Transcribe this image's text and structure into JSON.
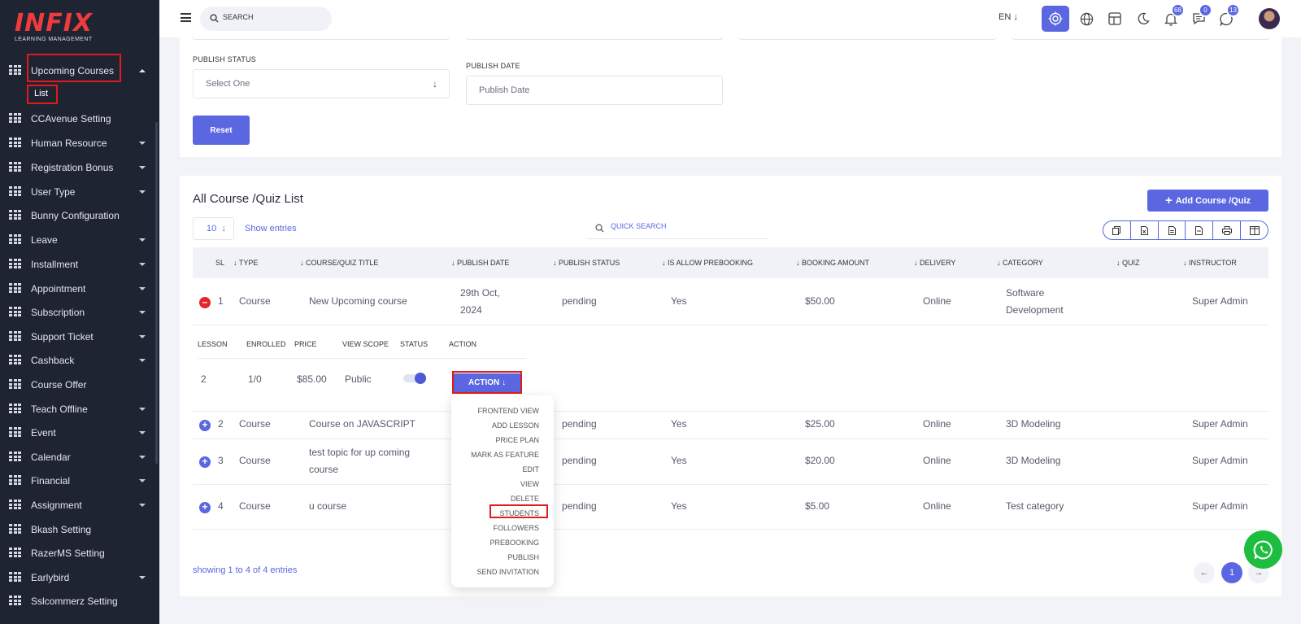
{
  "brand": {
    "name": "INFIX",
    "tagline": "LEARNING MANAGEMENT"
  },
  "sidebar": {
    "items": [
      {
        "label": "Upcoming Courses",
        "expanded": true
      },
      {
        "label": "CCAvenue Setting",
        "has_children": false
      },
      {
        "label": "Human Resource",
        "has_children": true
      },
      {
        "label": "Registration Bonus",
        "has_children": true
      },
      {
        "label": "User Type",
        "has_children": true
      },
      {
        "label": "Bunny Configuration",
        "has_children": false
      },
      {
        "label": "Leave",
        "has_children": true
      },
      {
        "label": "Installment",
        "has_children": true
      },
      {
        "label": "Appointment",
        "has_children": true
      },
      {
        "label": "Subscription",
        "has_children": true
      },
      {
        "label": "Support Ticket",
        "has_children": true
      },
      {
        "label": "Cashback",
        "has_children": true
      },
      {
        "label": "Course Offer",
        "has_children": false
      },
      {
        "label": "Teach Offline",
        "has_children": true
      },
      {
        "label": "Event",
        "has_children": true
      },
      {
        "label": "Calendar",
        "has_children": true
      },
      {
        "label": "Financial",
        "has_children": true
      },
      {
        "label": "Assignment",
        "has_children": true
      },
      {
        "label": "Bkash Setting",
        "has_children": false
      },
      {
        "label": "RazerMS Setting",
        "has_children": false
      },
      {
        "label": "Earlybird",
        "has_children": true
      },
      {
        "label": "Sslcommerz Setting",
        "has_children": false
      }
    ],
    "sub_item": "List"
  },
  "topbar": {
    "search_placeholder": "SEARCH",
    "language": "EN",
    "badges": {
      "notifications": "68",
      "messages": "0",
      "whatsapp": "13"
    }
  },
  "filters": {
    "publish_status_label": "PUBLISH STATUS",
    "publish_status_value": "Select One",
    "publish_date_label": "PUBLISH DATE",
    "publish_date_placeholder": "Publish Date",
    "reset_label": "Reset"
  },
  "list": {
    "title": "All Course /Quiz List",
    "add_button": "Add Course /Quiz",
    "entries_value": "10",
    "show_entries": "Show entries",
    "quick_search_placeholder": "QUICK SEARCH",
    "columns": [
      "SL",
      "TYPE",
      "COURSE/QUIZ TITLE",
      "PUBLISH DATE",
      "PUBLISH STATUS",
      "IS ALLOW PREBOOKING",
      "BOOKING AMOUNT",
      "DELIVERY",
      "CATEGORY",
      "QUIZ",
      "INSTRUCTOR"
    ],
    "rows": [
      {
        "sl": "1",
        "type": "Course",
        "title": "New Upcoming course",
        "date_line1": "29th Oct,",
        "date_line2": "2024",
        "status": "pending",
        "prebooking": "Yes",
        "amount": "$50.00",
        "delivery": "Online",
        "category_line1": "Software",
        "category_line2": "Development",
        "quiz": "",
        "instructor": "Super Admin"
      },
      {
        "sl": "2",
        "type": "Course",
        "title": "Course on JAVASCRIPT",
        "status": "pending",
        "prebooking": "Yes",
        "amount": "$25.00",
        "delivery": "Online",
        "category": "3D Modeling",
        "quiz": "",
        "instructor": "Super Admin"
      },
      {
        "sl": "3",
        "type": "Course",
        "title_line1": "test topic for up coming",
        "title_line2": "course",
        "status": "pending",
        "prebooking": "Yes",
        "amount": "$20.00",
        "delivery": "Online",
        "category": "3D Modeling",
        "quiz": "",
        "instructor": "Super Admin"
      },
      {
        "sl": "4",
        "type": "Course",
        "title": "u course",
        "status": "pending",
        "prebooking": "Yes",
        "amount": "$5.00",
        "delivery": "Online",
        "category": "Test category",
        "quiz": "",
        "instructor": "Super Admin"
      }
    ],
    "detail": {
      "columns": [
        "LESSON",
        "ENROLLED",
        "PRICE",
        "VIEW SCOPE",
        "STATUS",
        "ACTION"
      ],
      "lesson": "2",
      "enrolled": "1/0",
      "price": "$85.00",
      "view_scope": "Public",
      "status_on": true,
      "action_label": "ACTION"
    },
    "action_menu": [
      "FRONTEND VIEW",
      "ADD LESSON",
      "PRICE PLAN",
      "MARK AS FEATURE",
      "EDIT",
      "VIEW",
      "DELETE",
      "STUDENTS",
      "FOLLOWERS",
      "PREBOOKING",
      "PUBLISH",
      "SEND INVITATION"
    ],
    "footer_text": "showing 1 to 4 of 4 entries",
    "current_page": "1"
  },
  "colors": {
    "accent": "#5a67e0",
    "sidebar_bg": "#1f2433",
    "danger": "#e3272b",
    "highlight": "#e01b1b",
    "whatsapp": "#1dbe3f"
  }
}
